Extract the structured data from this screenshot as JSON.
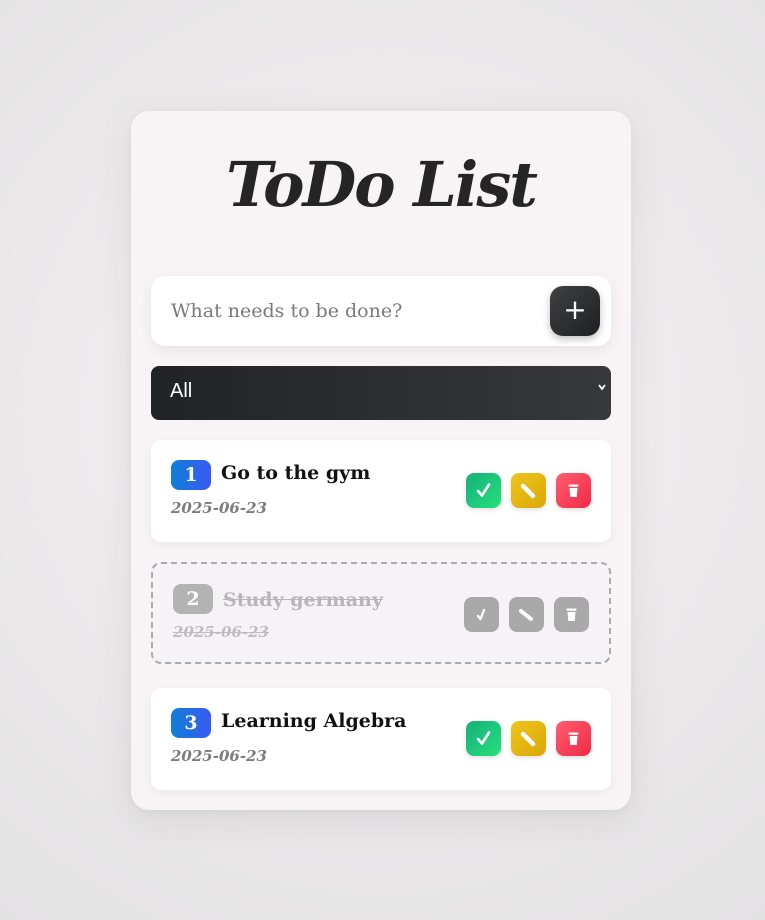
{
  "app": {
    "title": "ToDo List"
  },
  "input": {
    "placeholder": "What needs to be done?",
    "value": "",
    "add_label": "+"
  },
  "filter": {
    "selected": "All"
  },
  "todos": [
    {
      "number": "1",
      "title": "Go to the gym",
      "date": "2025-06-23",
      "completed": false
    },
    {
      "number": "2",
      "title": "Study germany",
      "date": "2025-06-23",
      "completed": true
    },
    {
      "number": "3",
      "title": "Learning Algebra",
      "date": "2025-06-23",
      "completed": false
    }
  ],
  "icons": {
    "add": "plus-icon",
    "complete": "check-icon",
    "edit": "pencil-icon",
    "delete": "trash-icon",
    "filter": "chevron-down-icon"
  },
  "colors": {
    "complete": "#1fc97a",
    "edit": "#e8b912",
    "delete": "#f83d56",
    "number_badge": "#2a6af0",
    "disabled": "#a9a9a9"
  }
}
